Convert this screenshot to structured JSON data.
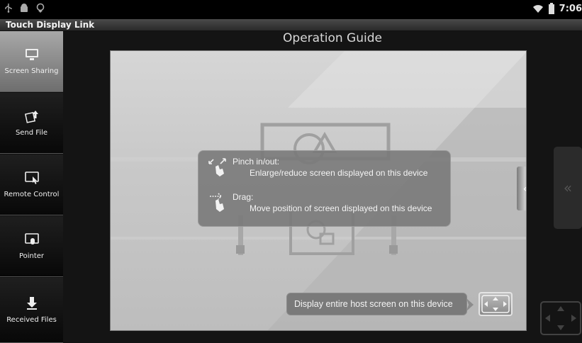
{
  "status_bar": {
    "time": "7:06"
  },
  "app": {
    "title": "Touch Display Link"
  },
  "sidebar": {
    "items": [
      {
        "label": "Screen Sharing",
        "icon": "monitor-icon",
        "active": true
      },
      {
        "label": "Send File",
        "icon": "send-file-icon",
        "active": false
      },
      {
        "label": "Remote Control",
        "icon": "remote-control-icon",
        "active": false
      },
      {
        "label": "Pointer",
        "icon": "pointer-icon",
        "active": false
      },
      {
        "label": "Received Files",
        "icon": "download-icon",
        "active": false
      }
    ]
  },
  "guide": {
    "title": "Operation Guide",
    "pinch": {
      "title": "Pinch in/out:",
      "description": "Enlarge/reduce screen displayed on this device"
    },
    "drag": {
      "title": "Drag:",
      "description": "Move position of screen displayed on this device"
    },
    "fit_hint": "Display entire host screen on this device",
    "collapse_glyph": "«"
  }
}
